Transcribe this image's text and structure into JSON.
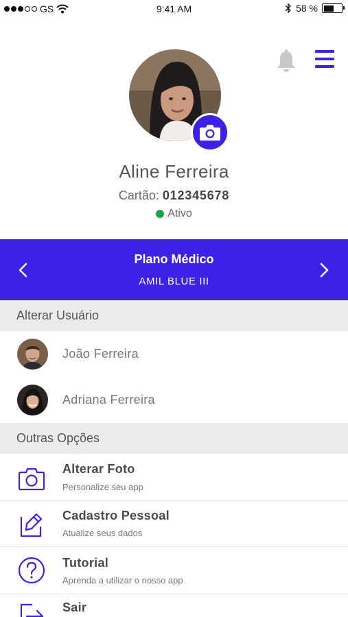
{
  "status_bar": {
    "carrier": "GS",
    "time": "9:41 AM",
    "battery": "58 %",
    "battery_level": 0.58
  },
  "profile": {
    "name": "Aline Ferreira",
    "card_label": "Cartão:",
    "card_number": "012345678",
    "status": "Ativo",
    "status_color": "#1aa34a"
  },
  "plan": {
    "title": "Plano Médico",
    "subtitle": "AMIL BLUE III"
  },
  "switch_user": {
    "header": "Alterar Usuário",
    "users": [
      {
        "name": "João Ferreira"
      },
      {
        "name": "Adriana Ferreira"
      }
    ]
  },
  "other_options": {
    "header": "Outras Opções",
    "items": [
      {
        "title": "Alterar Foto",
        "subtitle": "Personalize seu app",
        "icon": "camera-icon"
      },
      {
        "title": "Cadastro Pessoal",
        "subtitle": "Atualize seus dados",
        "icon": "edit-icon"
      },
      {
        "title": "Tutorial",
        "subtitle": "Aprenda a utilizar o nosso app",
        "icon": "question-icon"
      },
      {
        "title": "Sair",
        "subtitle": "",
        "icon": "logout-icon"
      }
    ]
  },
  "colors": {
    "accent": "#3b22e6",
    "section_bg": "#ebebeb"
  }
}
